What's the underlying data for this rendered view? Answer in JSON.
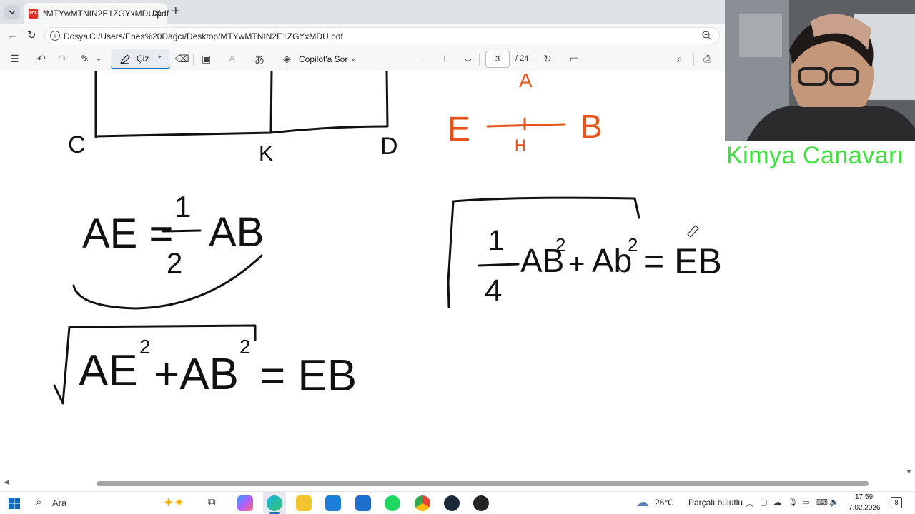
{
  "browser": {
    "tab_title": "*MTYwMTNIN2E1ZGYxMDU.pdf",
    "tab_favicon_text": "PDF",
    "url_label": "Dosya",
    "url": "C:/Users/Enes%20Dağcı/Desktop/MTYwMTNIN2E1ZGYxMDU.pdf"
  },
  "pdf_toolbar": {
    "draw_label": "Çiz",
    "copilot_label": "Copilot'a Sor",
    "current_page": "3",
    "total_pages": "/ 24"
  },
  "drawing": {
    "label_c": "C",
    "label_k": "K",
    "label_d": "D",
    "label_a": "A",
    "label_e": "E",
    "label_h": "H",
    "label_b": "B",
    "eq1_left": "AE =",
    "eq1_num": "1",
    "eq1_den": "2",
    "eq1_right": "AB",
    "eq2_main": "AE",
    "eq2_exp1": "2",
    "eq2_mid": "+AB",
    "eq2_exp2": "2",
    "eq2_right": "= EB",
    "eq3_num": "1",
    "eq3_den": "4",
    "eq3_term1": "AB",
    "eq3_exp1": "2",
    "eq3_plus": "+",
    "eq3_term2": "Ab",
    "eq3_exp2": "2",
    "eq3_right": "= EB",
    "ink_color": "#111111",
    "accent_color": "#e8531c"
  },
  "webcam": {
    "brand_text": "Kimya Canavarı",
    "brand_color": "#3de03d"
  },
  "taskbar": {
    "search_label": "Ara",
    "weather_temp": "26°C",
    "weather_desc": "Parçalı bulutlu",
    "time": "17:59",
    "date": "7.02.2026",
    "notification_count": "8"
  }
}
